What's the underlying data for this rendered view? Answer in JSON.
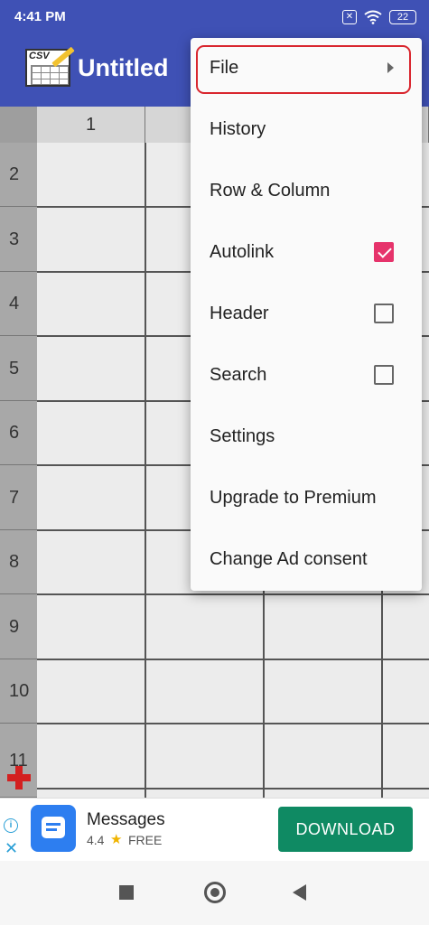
{
  "status_bar": {
    "time": "4:41 PM",
    "battery": "22"
  },
  "app_bar": {
    "logo_text": "CSV",
    "title": "Untitled"
  },
  "sheet": {
    "columns": [
      "1"
    ],
    "rows": [
      "2",
      "3",
      "4",
      "5",
      "6",
      "7",
      "8",
      "9",
      "10",
      "11"
    ]
  },
  "menu": {
    "items": [
      {
        "label": "File",
        "type": "submenu"
      },
      {
        "label": "History",
        "type": "plain"
      },
      {
        "label": "Row & Column",
        "type": "plain"
      },
      {
        "label": "Autolink",
        "type": "checkbox",
        "checked": true
      },
      {
        "label": "Header",
        "type": "checkbox",
        "checked": false
      },
      {
        "label": "Search",
        "type": "checkbox",
        "checked": false
      },
      {
        "label": "Settings",
        "type": "plain"
      },
      {
        "label": "Upgrade to Premium",
        "type": "plain"
      },
      {
        "label": "Change Ad consent",
        "type": "plain"
      }
    ]
  },
  "ad": {
    "app_name": "Messages",
    "rating": "4.4",
    "price": "FREE",
    "button": "DOWNLOAD",
    "close_glyph": "✕"
  },
  "colors": {
    "primary": "#3f51b5",
    "checkbox_accent": "#e6336b",
    "highlight_red": "#d9262e",
    "ad_button": "#0f8a63"
  }
}
